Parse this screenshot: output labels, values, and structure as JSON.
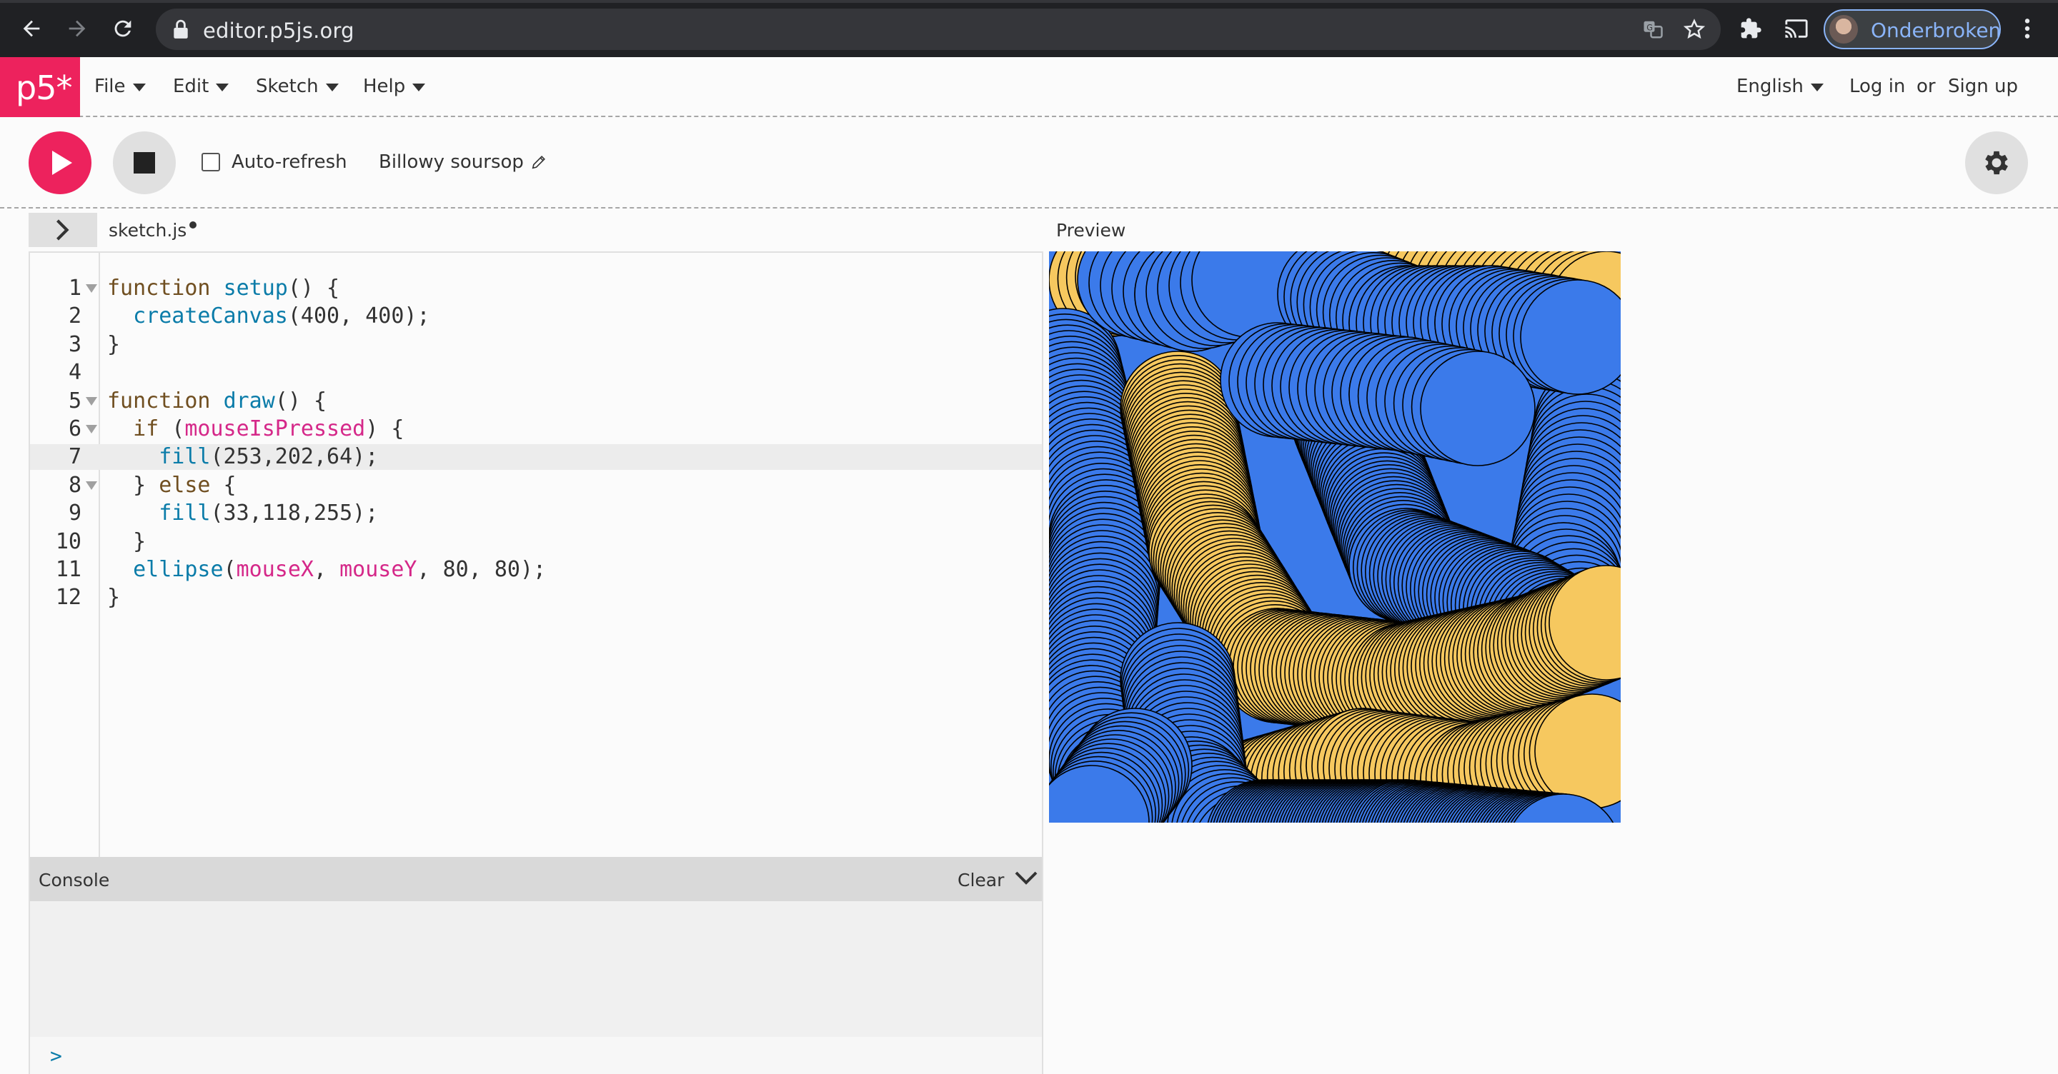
{
  "browser": {
    "url": "editor.p5js.org",
    "profile_name": "Onderbroken",
    "icons": [
      "back-arrow-icon",
      "forward-arrow-icon",
      "reload-icon",
      "lock-icon",
      "translate-icon",
      "star-icon",
      "extensions-icon",
      "cast-icon",
      "more-vert-icon"
    ]
  },
  "header": {
    "logo": "p5*",
    "menus": [
      "File",
      "Edit",
      "Sketch",
      "Help"
    ],
    "language": "English",
    "login": "Log in",
    "or": "or",
    "signup": "Sign up"
  },
  "toolbar": {
    "auto_refresh_label": "Auto-refresh",
    "auto_refresh_checked": false,
    "sketch_name": "Billowy soursop"
  },
  "editor": {
    "file_name": "sketch.js",
    "unsaved": true,
    "highlighted_line": 7,
    "lines": [
      {
        "n": "1",
        "fold": true
      },
      {
        "n": "2",
        "fold": false
      },
      {
        "n": "3",
        "fold": false
      },
      {
        "n": "4",
        "fold": false
      },
      {
        "n": "5",
        "fold": true
      },
      {
        "n": "6",
        "fold": true
      },
      {
        "n": "7",
        "fold": false
      },
      {
        "n": "8",
        "fold": true
      },
      {
        "n": "9",
        "fold": false
      },
      {
        "n": "10",
        "fold": false
      },
      {
        "n": "11",
        "fold": false
      },
      {
        "n": "12",
        "fold": false
      }
    ],
    "code": [
      "function setup() {",
      "  createCanvas(400, 400);",
      "}",
      "",
      "function draw() {",
      "  if (mouseIsPressed) {",
      "    fill(253,202,64);",
      "  } else {",
      "    fill(33,118,255);",
      "  }",
      "  ellipse(mouseX, mouseY, 80, 80);",
      "}"
    ]
  },
  "console": {
    "title": "Console",
    "clear_label": "Clear",
    "prompt": ">"
  },
  "preview": {
    "label": "Preview",
    "colors": {
      "yellow": "#f6c85f",
      "blue": "#3b7aea",
      "stroke": "#000000"
    }
  },
  "colors": {
    "accent": "#ed225d",
    "keyword": "#704f21",
    "function": "#0b7ca9",
    "variable": "#d52889"
  }
}
